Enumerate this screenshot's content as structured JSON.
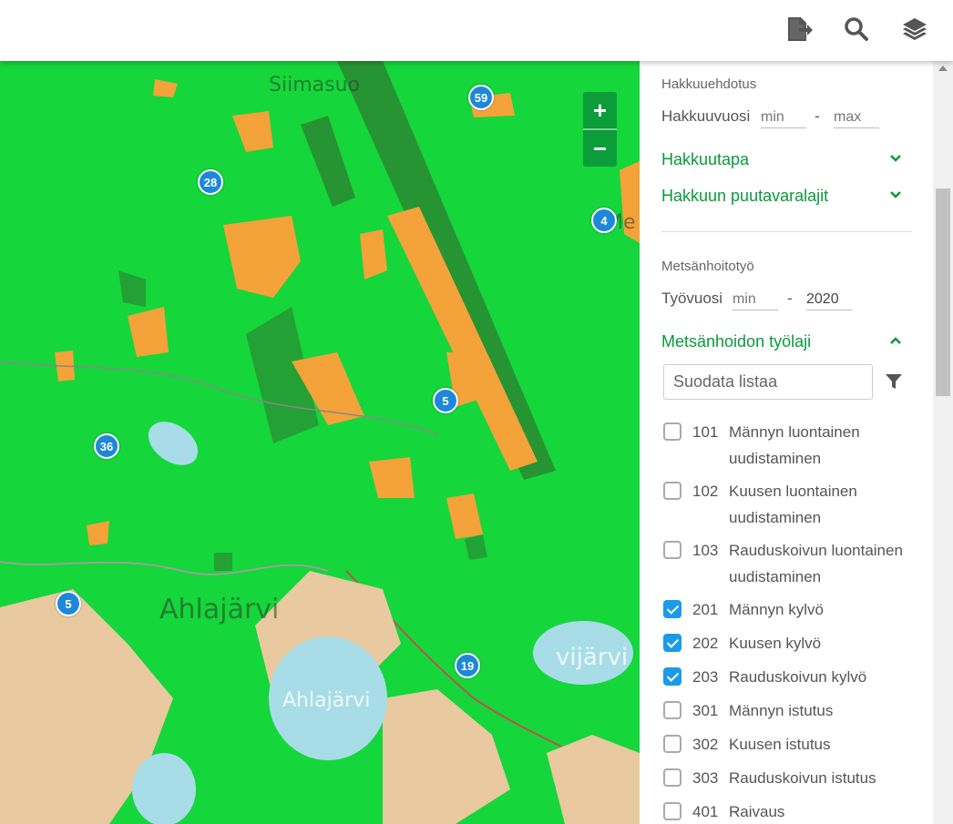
{
  "header": {
    "icons": [
      "export-icon",
      "search-icon",
      "layers-icon"
    ]
  },
  "map": {
    "place_labels": [
      "Siimasuo",
      "Ahlajärvi",
      "Ahlajärvi",
      "vijärvi",
      "Me"
    ],
    "markers": [
      "59",
      "28",
      "4",
      "5",
      "36",
      "5",
      "19"
    ],
    "zoom_in": "+",
    "zoom_out": "−"
  },
  "panel": {
    "harvest": {
      "section_label": "Hakkuuehdotus",
      "year_label": "Hakkuuvuosi",
      "min_placeholder": "min",
      "max_placeholder": "max",
      "dash": "-",
      "method_label": "Hakkuutapa",
      "species_label": "Hakkuun puutavaralajit"
    },
    "silviculture": {
      "section_label": "Metsänhoitotyö",
      "year_label": "Työvuosi",
      "min_placeholder": "min",
      "max_value": "2020",
      "dash": "-",
      "worktype_label": "Metsänhoidon työlaji",
      "filter_placeholder": "Suodata listaa",
      "items": [
        {
          "code": "101",
          "name": "Männyn luontainen uudistaminen",
          "checked": false
        },
        {
          "code": "102",
          "name": "Kuusen luontainen uudistaminen",
          "checked": false
        },
        {
          "code": "103",
          "name": "Rauduskoivun luontainen uudistaminen",
          "checked": false
        },
        {
          "code": "201",
          "name": "Männyn kylvö",
          "checked": true
        },
        {
          "code": "202",
          "name": "Kuusen kylvö",
          "checked": true
        },
        {
          "code": "203",
          "name": "Rauduskoivun kylvö",
          "checked": true
        },
        {
          "code": "301",
          "name": "Männyn istutus",
          "checked": false
        },
        {
          "code": "302",
          "name": "Kuusen istutus",
          "checked": false
        },
        {
          "code": "303",
          "name": "Rauduskoivun istutus",
          "checked": false
        },
        {
          "code": "401",
          "name": "Raivaus",
          "checked": false
        }
      ]
    }
  },
  "colors": {
    "accent": "#0a9a3c",
    "checkbox": "#1a9bea",
    "forest": "#15d63a",
    "harvest_area": "#f4a23a",
    "marker": "#1e88d8"
  }
}
